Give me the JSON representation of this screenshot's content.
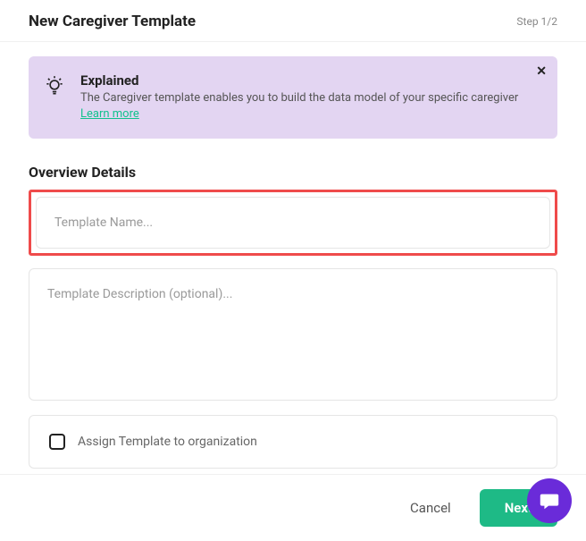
{
  "header": {
    "title": "New Caregiver Template",
    "step": "Step 1/2"
  },
  "info": {
    "title": "Explained",
    "desc": "The Caregiver template enables you to build the data model of your specific caregiver ",
    "link": "Learn more"
  },
  "section": {
    "title": "Overview Details"
  },
  "form": {
    "name_placeholder": "Template Name...",
    "name_value": "",
    "desc_placeholder": "Template Description (optional)...",
    "desc_value": "",
    "assign_label": "Assign Template to organization"
  },
  "footer": {
    "cancel": "Cancel",
    "next": "Next"
  }
}
